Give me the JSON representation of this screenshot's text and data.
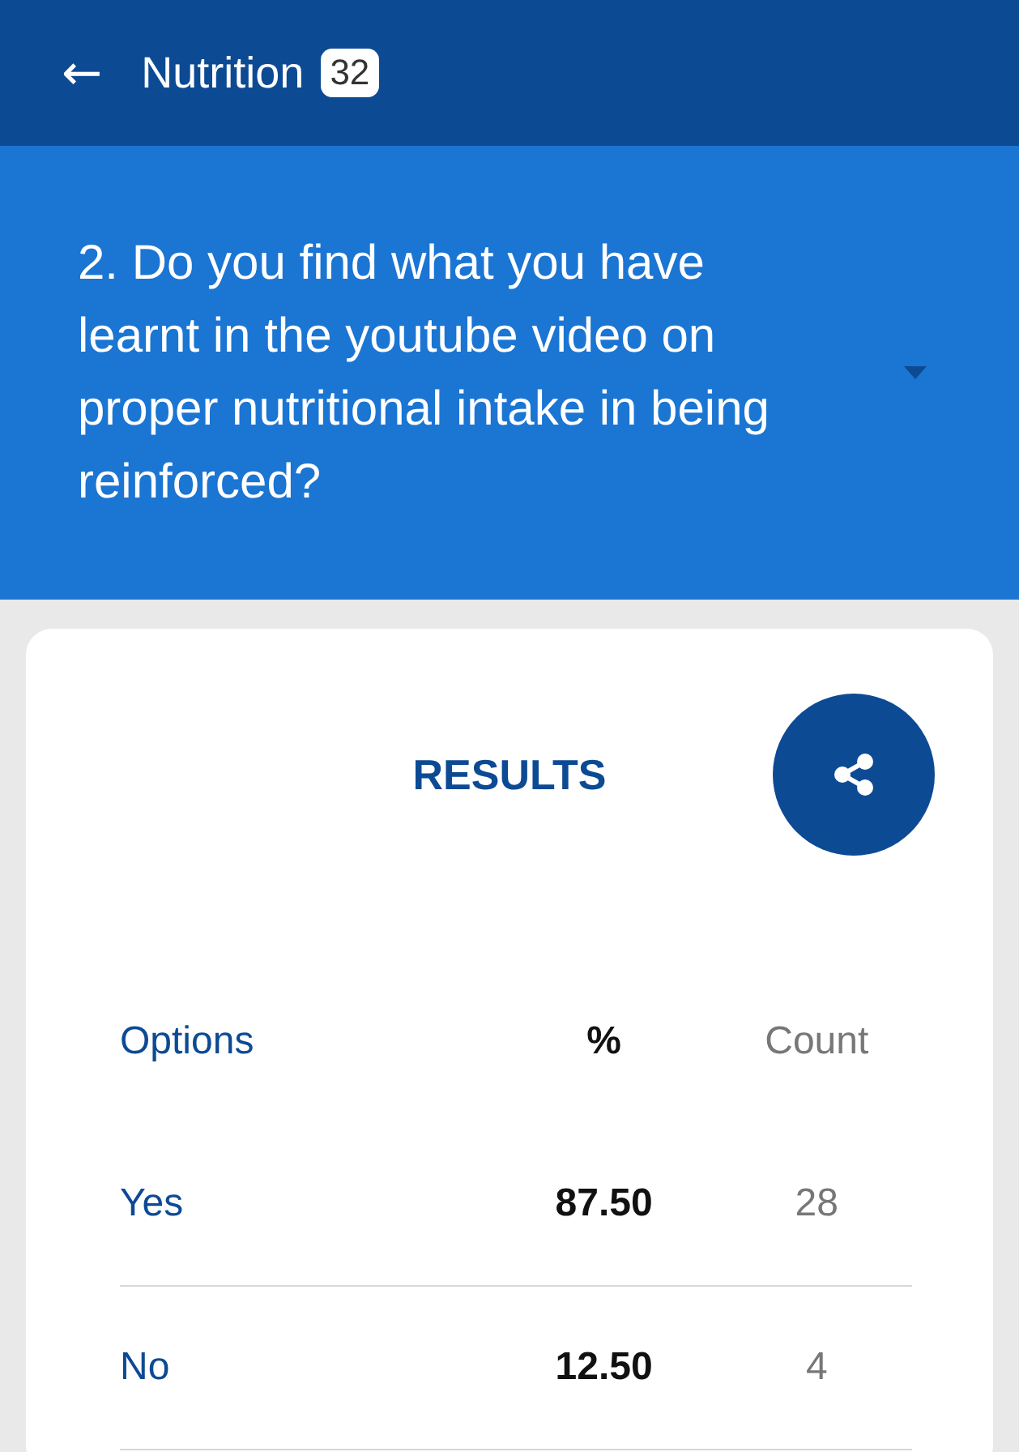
{
  "header": {
    "back_icon": "←",
    "title": "Nutrition",
    "badge": "32"
  },
  "question": {
    "text": "2. Do you find what you have learnt in the youtube video on proper nutritional intake in being reinforced?"
  },
  "results": {
    "title": "RESULTS",
    "columns": [
      "Options",
      "%",
      "Count"
    ],
    "rows": [
      {
        "option": "Yes",
        "percent": "87.50",
        "count": "28"
      },
      {
        "option": "No",
        "percent": "12.50",
        "count": "4"
      }
    ]
  }
}
